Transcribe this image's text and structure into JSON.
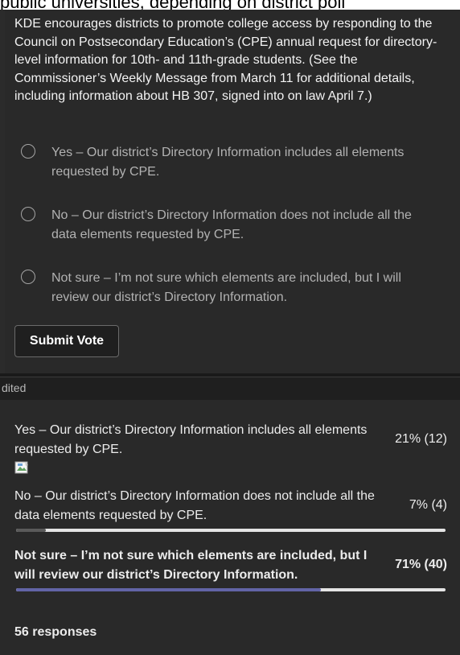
{
  "top_fragment": "public universities, depending on district poli",
  "question": {
    "text": "KDE encourages districts to promote college access by responding to the Council on Postsecondary Education’s (CPE) annual request for directory-level information for 10th- and 11th-grade students. (See the Commissioner’s Weekly Message from March 11 for additional details, including information about HB 307, signed into on law April 7.)"
  },
  "options": [
    {
      "label": "Yes – Our district’s Directory Information includes all elements requested by CPE."
    },
    {
      "label": "No – Our district’s Directory Information does not include all the data elements requested by CPE."
    },
    {
      "label": "Not sure – I’m not sure which elements are included, but I will review our district’s Directory Information."
    }
  ],
  "submit_label": "Submit Vote",
  "edited_label": "dited",
  "results": [
    {
      "label": "Yes – Our district’s Directory Information includes all elements requested by CPE.",
      "percent_text": "21% (12)",
      "fraction": 0.21,
      "bar_color": "",
      "has_broken_image": true
    },
    {
      "label": "No – Our district’s Directory Information does not include all the data elements requested by CPE.",
      "percent_text": "7% (4)",
      "fraction": 0.07,
      "bar_color": "#5a5a5a"
    },
    {
      "label": "Not sure – I’m not sure which elements are included, but I will review our district’s Directory Information.",
      "percent_text": "71% (40)",
      "fraction": 0.71,
      "bar_color": "#6264a7"
    }
  ],
  "responses_text": "56 responses",
  "colors": {
    "background": "#292929",
    "accent": "#6264a7",
    "track": "#e4e4e4"
  }
}
